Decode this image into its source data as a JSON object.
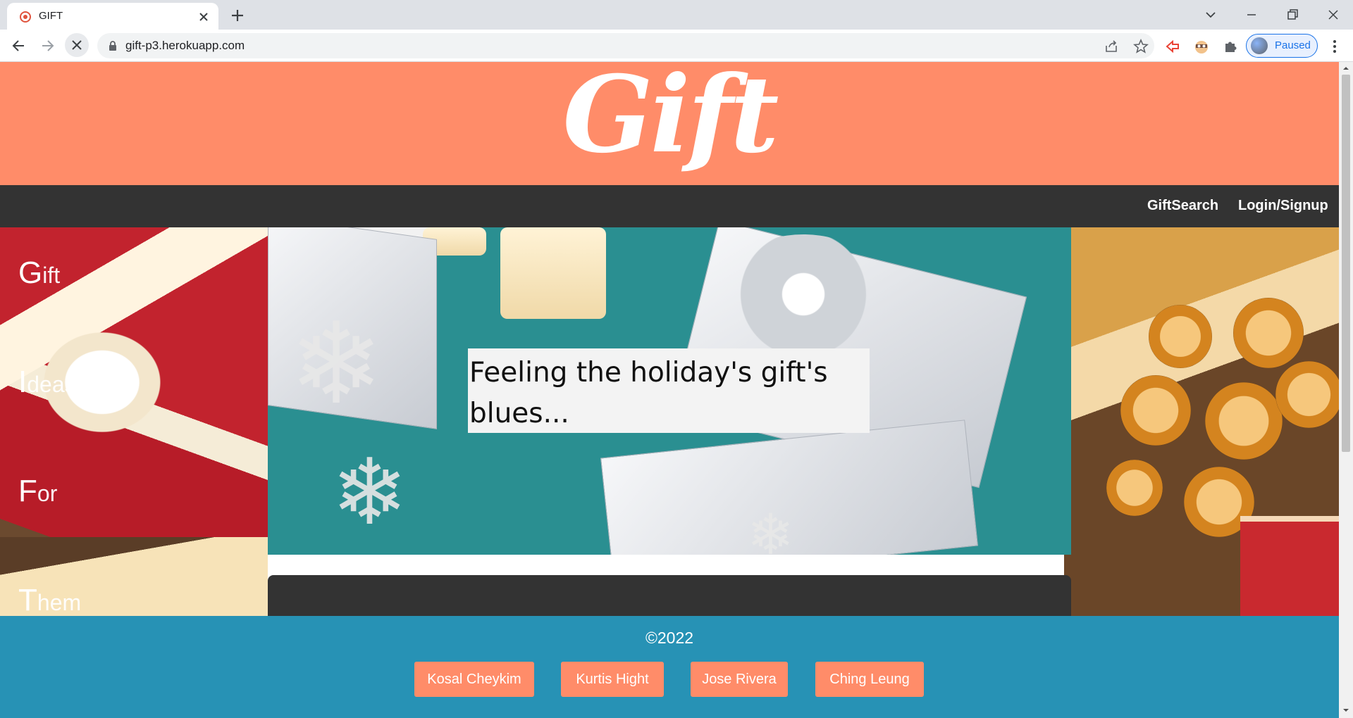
{
  "browser": {
    "tab_title": "GIFT",
    "url": "gift-p3.herokuapp.com",
    "profile_label": "Paused"
  },
  "site": {
    "logo": "Gift",
    "nav": {
      "items": [
        "GiftSearch",
        "Login/Signup"
      ]
    },
    "side_words": [
      {
        "cap": "G",
        "rest": "ift"
      },
      {
        "cap": "I",
        "rest": "deas"
      },
      {
        "cap": "F",
        "rest": "or"
      },
      {
        "cap": "T",
        "rest": "hem"
      }
    ],
    "hero_caption": "Feeling the holiday's gift's blues...",
    "footer": {
      "copyright": "©2022",
      "authors": [
        "Kosal Cheykim",
        "Kurtis Hight",
        "Jose Rivera",
        "Ching Leung"
      ]
    }
  },
  "colors": {
    "header": "#ff8c69",
    "nav": "#333333",
    "footer": "#2792b5",
    "author_button": "#ff8c69"
  }
}
